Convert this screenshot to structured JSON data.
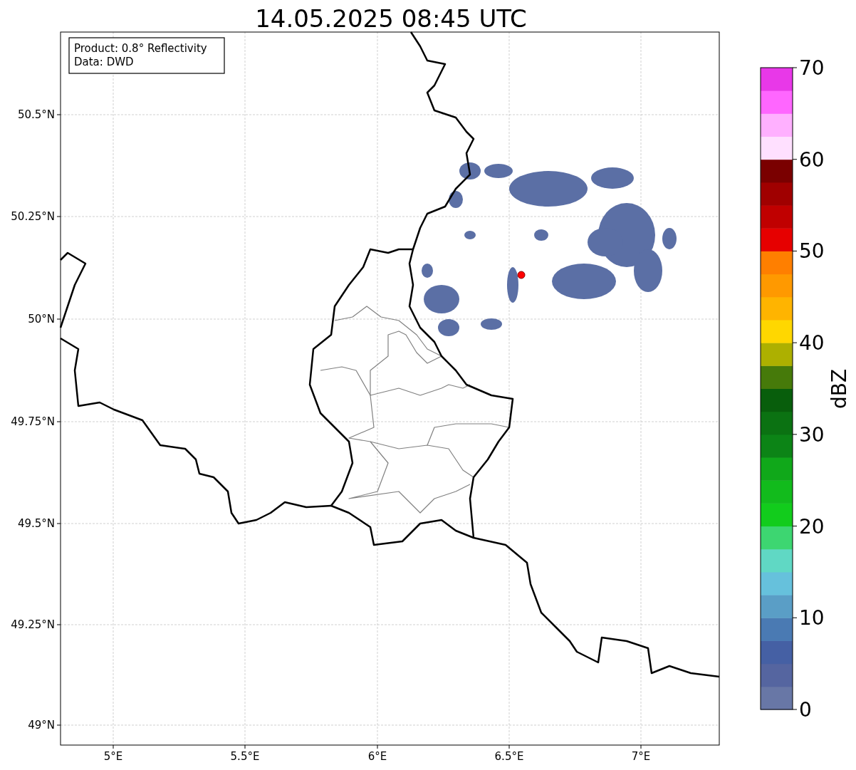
{
  "title": "14.05.2025 08:45 UTC",
  "info_box": [
    "Product: 0.8° Reflectivity",
    "Data: DWD"
  ],
  "y_ticks": [
    "50.5°N",
    "50.25°N",
    "50°N",
    "49.75°N",
    "49.5°N",
    "49.25°N",
    "49°N"
  ],
  "x_ticks": [
    "5°E",
    "5.5°E",
    "6°E",
    "6.5°E",
    "7°E"
  ],
  "colorbar": {
    "label": "dBZ",
    "ticks": [
      "70",
      "60",
      "50",
      "40",
      "30",
      "20",
      "10",
      "0"
    ],
    "bands": [
      {
        "color": "#6877a6"
      },
      {
        "color": "#5565a0"
      },
      {
        "color": "#4560a4"
      },
      {
        "color": "#4a7ab3"
      },
      {
        "color": "#5a9ec6"
      },
      {
        "color": "#66c1dc"
      },
      {
        "color": "#60d8c4"
      },
      {
        "color": "#3dd671"
      },
      {
        "color": "#12cc1c"
      },
      {
        "color": "#12bb1c"
      },
      {
        "color": "#10a81a"
      },
      {
        "color": "#0c8416"
      },
      {
        "color": "#0b7212"
      },
      {
        "color": "#085e0c"
      },
      {
        "color": "#467a0a"
      },
      {
        "color": "#adb000"
      },
      {
        "color": "#ffd700"
      },
      {
        "color": "#ffb400"
      },
      {
        "color": "#ff9900"
      },
      {
        "color": "#ff7f00"
      },
      {
        "color": "#e60000"
      },
      {
        "color": "#c00000"
      },
      {
        "color": "#a00000"
      },
      {
        "color": "#7a0000"
      },
      {
        "color": "#ffe0ff"
      },
      {
        "color": "#ffb0ff"
      },
      {
        "color": "#ff66ff"
      },
      {
        "color": "#e838e8"
      }
    ]
  }
}
